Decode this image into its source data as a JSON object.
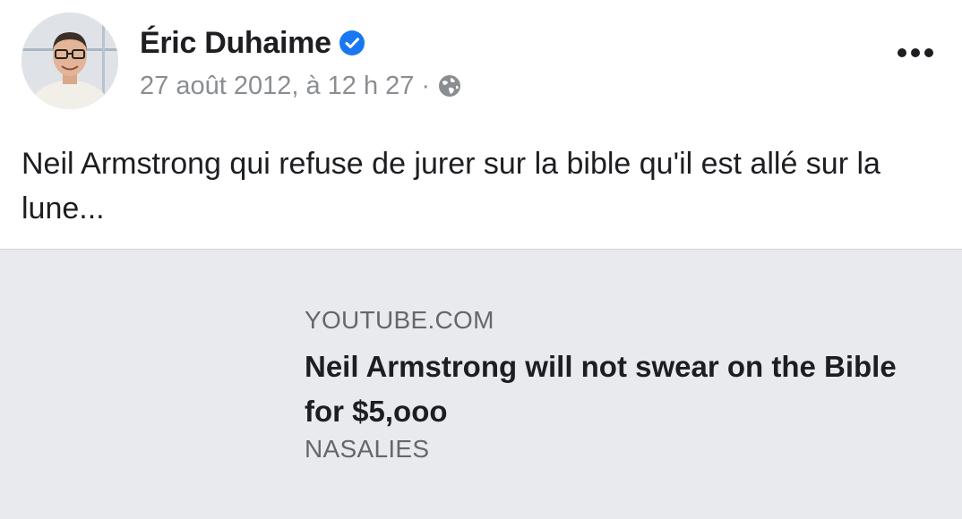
{
  "post": {
    "author": {
      "name": "Éric Duhaime",
      "verified": true,
      "avatar_icon": "profile-photo"
    },
    "timestamp": "27 août 2012, à 12 h 27",
    "separator": "·",
    "audience_icon": "globe-icon",
    "more_icon": "more-options-icon",
    "text": "Neil Armstrong qui refuse de jurer sur la bible qu'il est allé sur la lune..."
  },
  "link_preview": {
    "domain": "YOUTUBE.COM",
    "title": "Neil Armstrong will not swear on the Bible for $5,ooo",
    "source": "NASALIES"
  },
  "colors": {
    "verified_blue": "#1877f2",
    "text_primary": "#1c1e21",
    "text_secondary": "#8a8d91",
    "card_background": "#e9eaee"
  }
}
